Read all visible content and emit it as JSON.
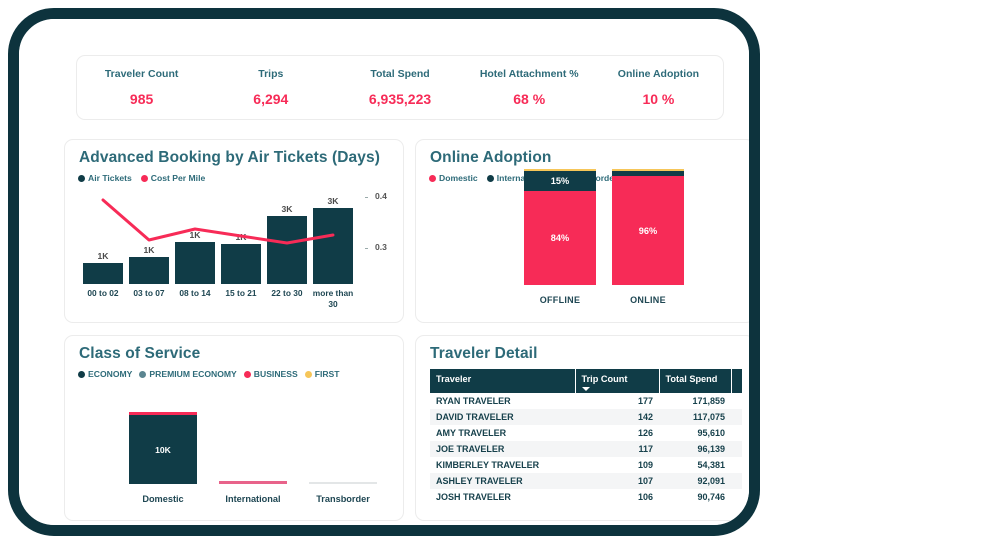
{
  "colors": {
    "frame": "#0d333d",
    "dark_teal": "#103c47",
    "pink": "#f72b57",
    "title_teal": "#2d6a78",
    "gray_blue": "#5b8590",
    "amber": "#f6c659",
    "light_gray": "#e8eaeb"
  },
  "kpi": {
    "items": [
      {
        "label": "Traveler Count",
        "value": "985"
      },
      {
        "label": "Trips",
        "value": "6,294"
      },
      {
        "label": "Total Spend",
        "value": "6,935,223"
      },
      {
        "label": "Hotel Attachment %",
        "value": "68 %"
      },
      {
        "label": "Online Adoption",
        "value": "10 %"
      }
    ]
  },
  "advanced_booking": {
    "title": "Advanced Booking by Air Tickets (Days)",
    "legend": [
      {
        "label": "Air Tickets",
        "color": "#103c47"
      },
      {
        "label": "Cost Per Mile",
        "color": "#f72b57"
      }
    ]
  },
  "online_adoption": {
    "title": "Online Adoption",
    "legend": [
      {
        "label": "Domestic",
        "color": "#f72b57"
      },
      {
        "label": "International",
        "color": "#103c47"
      },
      {
        "label": "Transborder",
        "color": "#f6c659"
      }
    ]
  },
  "class_of_service": {
    "title": "Class of Service",
    "legend": [
      {
        "label": "ECONOMY",
        "color": "#103c47"
      },
      {
        "label": "PREMIUM ECONOMY",
        "color": "#5b8590"
      },
      {
        "label": "BUSINESS",
        "color": "#f72b57"
      },
      {
        "label": "FIRST",
        "color": "#f6c659"
      }
    ]
  },
  "traveler_detail": {
    "title": "Traveler Detail",
    "columns": [
      "Traveler",
      "Trip Count",
      "Total Spend",
      ""
    ],
    "sorted_by": "Trip Count",
    "rows": [
      {
        "traveler": "RYAN TRAVELER",
        "trip_count": "177",
        "total_spend": "171,859"
      },
      {
        "traveler": "DAVID TRAVELER",
        "trip_count": "142",
        "total_spend": "117,075"
      },
      {
        "traveler": "AMY TRAVELER",
        "trip_count": "126",
        "total_spend": "95,610"
      },
      {
        "traveler": "JOE TRAVELER",
        "trip_count": "117",
        "total_spend": "96,139"
      },
      {
        "traveler": "KIMBERLEY TRAVELER",
        "trip_count": "109",
        "total_spend": "54,381"
      },
      {
        "traveler": "ASHLEY TRAVELER",
        "trip_count": "107",
        "total_spend": "92,091"
      },
      {
        "traveler": "JOSH TRAVELER",
        "trip_count": "106",
        "total_spend": "90,746"
      }
    ]
  },
  "chart_data": [
    {
      "type": "bar",
      "id": "advanced-booking",
      "title": "Advanced Booking by Air Tickets (Days)",
      "xlabel": "",
      "ylabel": "",
      "categories": [
        "00 to 02",
        "03 to 07",
        "08 to 14",
        "15 to 21",
        "22 to 30",
        "more than 30"
      ],
      "series": [
        {
          "name": "Air Tickets",
          "type": "bar",
          "color": "#103c47",
          "values": [
            900,
            1100,
            1500,
            1450,
            2900,
            3100
          ],
          "labels": [
            "1K",
            "1K",
            "1K",
            "1K",
            "3K",
            "3K"
          ],
          "axis": "left"
        },
        {
          "name": "Cost Per Mile",
          "type": "line",
          "color": "#f72b57",
          "values": [
            0.385,
            0.288,
            0.305,
            0.295,
            0.288,
            0.298
          ],
          "axis": "right"
        }
      ],
      "right_axis": {
        "ticks": [
          "0.4",
          "0.3"
        ],
        "values": [
          0.4,
          0.3
        ]
      },
      "grid": false,
      "legend_position": "top-left"
    },
    {
      "type": "bar",
      "id": "online-adoption",
      "title": "Online Adoption",
      "stacked": true,
      "normalized_percent": true,
      "categories": [
        "OFFLINE",
        "ONLINE"
      ],
      "series": [
        {
          "name": "Domestic",
          "color": "#f72b57",
          "values": [
            84,
            96
          ],
          "labels": [
            "84%",
            "96%"
          ]
        },
        {
          "name": "International",
          "color": "#103c47",
          "values": [
            15,
            3
          ],
          "labels": [
            "15%",
            ""
          ]
        },
        {
          "name": "Transborder",
          "color": "#f6c659",
          "values": [
            1,
            1
          ],
          "labels": [
            "",
            ""
          ]
        }
      ],
      "grid": false,
      "legend_position": "top-left"
    },
    {
      "type": "bar",
      "id": "class-of-service",
      "title": "Class of Service",
      "stacked": true,
      "categories": [
        "Domestic",
        "International",
        "Transborder"
      ],
      "series": [
        {
          "name": "ECONOMY",
          "color": "#103c47",
          "values": [
            10000,
            0,
            0
          ],
          "labels": [
            "10K",
            "",
            ""
          ]
        },
        {
          "name": "PREMIUM ECONOMY",
          "color": "#5b8590",
          "values": [
            0,
            0,
            60
          ],
          "labels": [
            "",
            "",
            ""
          ]
        },
        {
          "name": "BUSINESS",
          "color": "#f72b57",
          "values": [
            120,
            90,
            0
          ],
          "labels": [
            "",
            "",
            ""
          ]
        },
        {
          "name": "FIRST",
          "color": "#f6c659",
          "values": [
            0,
            0,
            0
          ],
          "labels": [
            "",
            "",
            ""
          ]
        }
      ],
      "grid": false,
      "legend_position": "top-left"
    },
    {
      "type": "table",
      "id": "traveler-detail",
      "title": "Traveler Detail",
      "columns": [
        "Traveler",
        "Trip Count",
        "Total Spend"
      ],
      "rows": [
        [
          "RYAN TRAVELER",
          177,
          171859
        ],
        [
          "DAVID TRAVELER",
          142,
          117075
        ],
        [
          "AMY TRAVELER",
          126,
          95610
        ],
        [
          "JOE TRAVELER",
          117,
          96139
        ],
        [
          "KIMBERLEY TRAVELER",
          109,
          54381
        ],
        [
          "ASHLEY TRAVELER",
          107,
          92091
        ],
        [
          "JOSH TRAVELER",
          106,
          90746
        ]
      ]
    }
  ]
}
